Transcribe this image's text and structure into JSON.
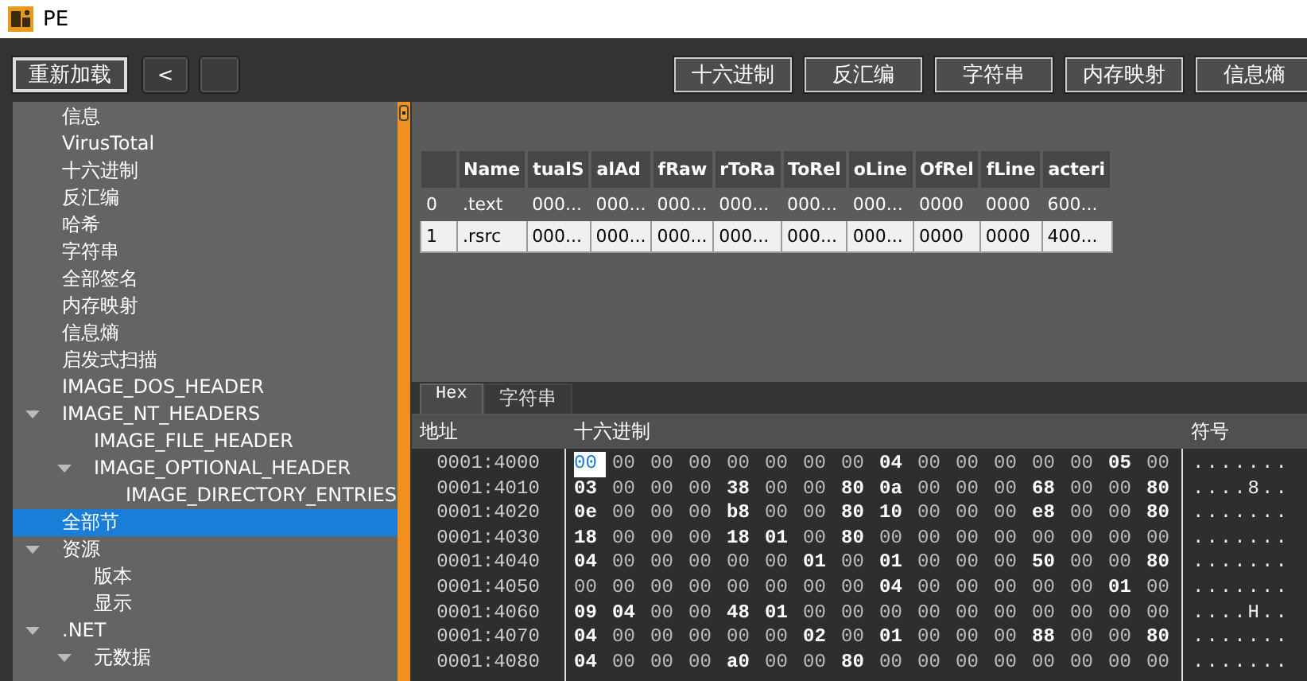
{
  "window": {
    "title": "PE"
  },
  "toolbar": {
    "left_buttons": [
      {
        "label": "重新加载",
        "focused": true
      },
      {
        "label": "<",
        "focused": false
      },
      {
        "focused": false
      }
    ],
    "right_buttons": [
      "十六进制",
      "反汇编",
      "字符串",
      "内存映射",
      "信息熵"
    ]
  },
  "tree": [
    {
      "label": "信息"
    },
    {
      "label": "VirusTotal"
    },
    {
      "label": "十六进制"
    },
    {
      "label": "反汇编"
    },
    {
      "label": "哈希"
    },
    {
      "label": "字符串"
    },
    {
      "label": "全部签名"
    },
    {
      "label": "内存映射"
    },
    {
      "label": "信息熵"
    },
    {
      "label": "启发式扫描"
    },
    {
      "label": "IMAGE_DOS_HEADER"
    },
    {
      "label": "IMAGE_NT_HEADERS",
      "expanded": true,
      "children": [
        {
          "label": "IMAGE_FILE_HEADER"
        },
        {
          "label": "IMAGE_OPTIONAL_HEADER",
          "expanded": true,
          "children": [
            {
              "label": "IMAGE_DIRECTORY_ENTRIES"
            }
          ]
        }
      ]
    },
    {
      "label": "全部节",
      "selected": true
    },
    {
      "label": "资源",
      "expanded": true,
      "children": [
        {
          "label": "版本"
        },
        {
          "label": "显示"
        }
      ]
    },
    {
      "label": ".NET",
      "expanded": true,
      "children": [
        {
          "label": "元数据",
          "expanded": true
        }
      ]
    }
  ],
  "sections_table": {
    "columns": [
      "",
      "Name",
      "tualS",
      "alAd",
      "fRaw",
      "rToRa",
      "ToRel",
      "oLine",
      "OfRel",
      "fLine",
      "acteri"
    ],
    "rows": [
      {
        "selected": false,
        "cells": [
          "0",
          ".text",
          "000...",
          "000...",
          "000...",
          "000...",
          "000...",
          "000...",
          "0000",
          "0000",
          "600..."
        ]
      },
      {
        "selected": true,
        "cells": [
          "1",
          ".rsrc",
          "000...",
          "000...",
          "000...",
          "000...",
          "000...",
          "000...",
          "0000",
          "0000",
          "400..."
        ]
      }
    ]
  },
  "view_tabs": [
    {
      "label": "Hex",
      "selected": true
    },
    {
      "label": "字符串",
      "selected": false
    }
  ],
  "hex_view": {
    "columns": [
      "地址",
      "十六进制",
      "符号"
    ],
    "rows": [
      {
        "address": "0001:4000",
        "cursor": true,
        "bytes": [
          "00",
          "00",
          "00",
          "00",
          "00",
          "00",
          "00",
          "00",
          "04",
          "00",
          "00",
          "00",
          "00",
          "00",
          "05",
          "00"
        ],
        "symbols": "......."
      },
      {
        "address": "0001:4010",
        "cursor": false,
        "bytes": [
          "03",
          "00",
          "00",
          "00",
          "38",
          "00",
          "00",
          "80",
          "0a",
          "00",
          "00",
          "00",
          "68",
          "00",
          "00",
          "80"
        ],
        "symbols": "....8.."
      },
      {
        "address": "0001:4020",
        "cursor": false,
        "bytes": [
          "0e",
          "00",
          "00",
          "00",
          "b8",
          "00",
          "00",
          "80",
          "10",
          "00",
          "00",
          "00",
          "e8",
          "00",
          "00",
          "80"
        ],
        "symbols": "......."
      },
      {
        "address": "0001:4030",
        "cursor": false,
        "bytes": [
          "18",
          "00",
          "00",
          "00",
          "18",
          "01",
          "00",
          "80",
          "00",
          "00",
          "00",
          "00",
          "00",
          "00",
          "00",
          "00"
        ],
        "symbols": "......."
      },
      {
        "address": "0001:4040",
        "cursor": false,
        "bytes": [
          "04",
          "00",
          "00",
          "00",
          "00",
          "00",
          "01",
          "00",
          "01",
          "00",
          "00",
          "00",
          "50",
          "00",
          "00",
          "80"
        ],
        "symbols": "......."
      },
      {
        "address": "0001:4050",
        "cursor": false,
        "bytes": [
          "00",
          "00",
          "00",
          "00",
          "00",
          "00",
          "00",
          "00",
          "04",
          "00",
          "00",
          "00",
          "00",
          "00",
          "01",
          "00"
        ],
        "symbols": "......."
      },
      {
        "address": "0001:4060",
        "cursor": false,
        "bytes": [
          "09",
          "04",
          "00",
          "00",
          "48",
          "01",
          "00",
          "00",
          "00",
          "00",
          "00",
          "00",
          "00",
          "00",
          "00",
          "00"
        ],
        "symbols": "....H.."
      },
      {
        "address": "0001:4070",
        "cursor": false,
        "bytes": [
          "04",
          "00",
          "00",
          "00",
          "00",
          "00",
          "02",
          "00",
          "01",
          "00",
          "00",
          "00",
          "88",
          "00",
          "00",
          "80"
        ],
        "symbols": "......."
      },
      {
        "address": "0001:4080",
        "cursor": false,
        "bytes": [
          "04",
          "00",
          "00",
          "00",
          "a0",
          "00",
          "00",
          "80",
          "00",
          "00",
          "00",
          "00",
          "00",
          "00",
          "00",
          "00"
        ],
        "symbols": "......."
      }
    ]
  }
}
